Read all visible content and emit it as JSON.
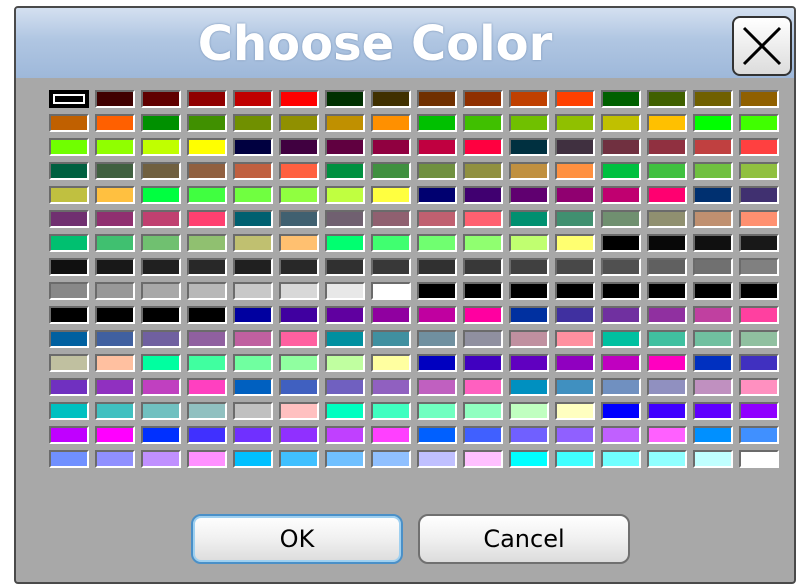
{
  "dialog": {
    "title": "Choose Color",
    "close_icon": "close-icon",
    "ok_label": "OK",
    "cancel_label": "Cancel"
  },
  "colors": {
    "title_bar": "#b0c6e2",
    "title_text": "#ffffff",
    "dialog_bg": "#a8a8a8",
    "ok_focus": "#4a90c8"
  },
  "palette": {
    "columns": 16,
    "selected_index": 0,
    "swatches": [
      "#000000",
      "#400000",
      "#600000",
      "#900000",
      "#c00000",
      "#ff0000",
      "#003000",
      "#403000",
      "#703000",
      "#903000",
      "#c04000",
      "#ff4000",
      "#006000",
      "#406000",
      "#706000",
      "#906000",
      "#c06000",
      "#ff6000",
      "#009000",
      "#409000",
      "#709000",
      "#909000",
      "#c09000",
      "#ff9000",
      "#00c000",
      "#40c000",
      "#70c000",
      "#90c000",
      "#c0c000",
      "#ffc000",
      "#00ff00",
      "#40ff00",
      "#70ff00",
      "#90ff00",
      "#c0ff00",
      "#ffff00",
      "#000040",
      "#400040",
      "#600040",
      "#900040",
      "#c00040",
      "#ff0040",
      "#003040",
      "#403040",
      "#703040",
      "#903040",
      "#c04040",
      "#ff4040",
      "#006040",
      "#406040",
      "#706040",
      "#906040",
      "#c06040",
      "#ff6040",
      "#009040",
      "#409040",
      "#709040",
      "#909040",
      "#c09040",
      "#ff9040",
      "#00c040",
      "#40c040",
      "#70c040",
      "#90c040",
      "#c0c040",
      "#ffc040",
      "#00ff40",
      "#40ff40",
      "#70ff40",
      "#90ff40",
      "#c0ff40",
      "#ffff40",
      "#000070",
      "#400070",
      "#600070",
      "#900070",
      "#c00070",
      "#ff0070",
      "#003070",
      "#403070",
      "#703070",
      "#903070",
      "#c04070",
      "#ff4070",
      "#006070",
      "#406070",
      "#706070",
      "#906070",
      "#c06070",
      "#ff6070",
      "#009070",
      "#409070",
      "#709070",
      "#909070",
      "#c09070",
      "#ff9070",
      "#00c070",
      "#40c070",
      "#70c070",
      "#90c070",
      "#c0c070",
      "#ffc070",
      "#00ff70",
      "#40ff70",
      "#70ff70",
      "#90ff70",
      "#c0ff70",
      "#ffff70",
      "#000000",
      "#080808",
      "#101010",
      "#181818",
      "#101010",
      "#181818",
      "#202020",
      "#282828",
      "#202020",
      "#282828",
      "#303030",
      "#383838",
      "#303030",
      "#383838",
      "#404040",
      "#484848",
      "#505050",
      "#606060",
      "#707070",
      "#808080",
      "#888888",
      "#989898",
      "#a8a8a8",
      "#b8b8b8",
      "#c8c8c8",
      "#d8d8d8",
      "#e8e8e8",
      "#ffffff",
      "#000000",
      "#000000",
      "#000000",
      "#000000",
      "#000000",
      "#000000",
      "#000000",
      "#000000",
      "#000000",
      "#000000",
      "#000000",
      "#000000",
      "#0000a0",
      "#4000a0",
      "#6000a0",
      "#9000a0",
      "#c000a0",
      "#ff00a0",
      "#0030a0",
      "#4030a0",
      "#7030a0",
      "#9030a0",
      "#c040a0",
      "#ff40a0",
      "#0060a0",
      "#4060a0",
      "#7060a0",
      "#9060a0",
      "#c060a0",
      "#ff60a0",
      "#0090a0",
      "#4090a0",
      "#7090a0",
      "#9090a0",
      "#c090a0",
      "#ff90a0",
      "#00c0a0",
      "#40c0a0",
      "#70c0a0",
      "#90c0a0",
      "#c0c0a0",
      "#ffc0a0",
      "#00ffa0",
      "#40ffa0",
      "#70ffa0",
      "#90ffa0",
      "#c0ffa0",
      "#ffffa0",
      "#0000c0",
      "#4000c0",
      "#6000c0",
      "#9000c0",
      "#c000c0",
      "#ff00c0",
      "#0030c0",
      "#4030c0",
      "#7030c0",
      "#9030c0",
      "#c040c0",
      "#ff40c0",
      "#0060c0",
      "#4060c0",
      "#7060c0",
      "#9060c0",
      "#c060c0",
      "#ff60c0",
      "#0090c0",
      "#4090c0",
      "#7090c0",
      "#9090c0",
      "#c090c0",
      "#ff90c0",
      "#00c0c0",
      "#40c0c0",
      "#70c0c0",
      "#90c0c0",
      "#c0c0c0",
      "#ffc0c0",
      "#00ffc0",
      "#40ffc0",
      "#70ffc0",
      "#90ffc0",
      "#c0ffc0",
      "#ffffc0",
      "#0000ff",
      "#4000ff",
      "#6000ff",
      "#9000ff",
      "#c000ff",
      "#ff00ff",
      "#0030ff",
      "#4030ff",
      "#7030ff",
      "#9030ff",
      "#c040ff",
      "#ff40ff",
      "#0060ff",
      "#4060ff",
      "#7060ff",
      "#9060ff",
      "#c060ff",
      "#ff60ff",
      "#0090ff",
      "#4090ff",
      "#7090ff",
      "#9090ff",
      "#c090ff",
      "#ff90ff",
      "#00c0ff",
      "#40c0ff",
      "#70c0ff",
      "#90c0ff",
      "#c0c0ff",
      "#ffc0ff",
      "#00ffff",
      "#40ffff",
      "#70ffff",
      "#90ffff",
      "#c0ffff",
      "#ffffff"
    ]
  }
}
